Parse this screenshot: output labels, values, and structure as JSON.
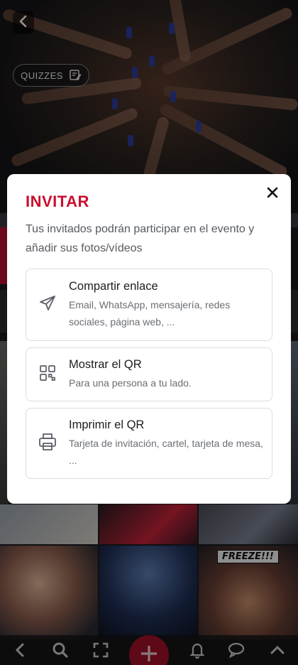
{
  "header": {
    "back_icon": "chevron-left-icon",
    "quiz_label": "QUIZZES",
    "quiz_icon": "edit-note-icon"
  },
  "modal": {
    "title": "INVITAR",
    "close_icon": "close-icon",
    "description": "Tus invitados podrán participar en el evento y añadir sus fotos/vídeos",
    "options": [
      {
        "icon": "send-icon",
        "title": "Compartir enlace",
        "subtitle": "Email, WhatsApp, mensajería, redes sociales, página web, ..."
      },
      {
        "icon": "qr-code-icon",
        "title": "Mostrar el QR",
        "subtitle": "Para una persona a tu lado."
      },
      {
        "icon": "printer-icon",
        "title": "Imprimir el QR",
        "subtitle": "Tarjeta de invitación, cartel, tarjeta de mesa, ..."
      }
    ]
  },
  "gallery": {
    "freeze_label": "FREEZE!!!"
  },
  "bottom_nav": {
    "items": [
      "chevron-left-icon",
      "search-icon",
      "fullscreen-icon",
      "add-icon",
      "bell-icon",
      "chat-icon",
      "chevron-up-icon"
    ]
  },
  "colors": {
    "accent": "#c8102e",
    "add_button": "#a3102a",
    "text_dark": "#1e1e1e",
    "text_muted": "#6a6e73"
  }
}
